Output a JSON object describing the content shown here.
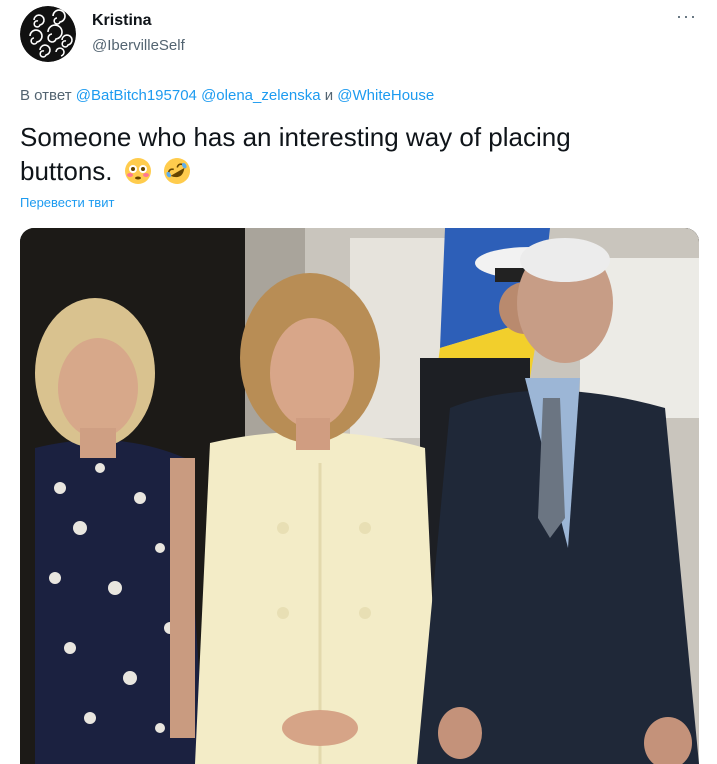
{
  "author": {
    "display_name": "Kristina",
    "handle": "@IbervilleSelf",
    "avatar_icon": "swirl-pattern-avatar"
  },
  "more_icon": "more-options-icon",
  "more_glyph": "···",
  "reply": {
    "prefix": "В ответ",
    "mention1": "@BatBitch195704",
    "mention2": "@olena_zelenska",
    "conjunction": "и",
    "mention3": "@WhiteHouse"
  },
  "tweet": {
    "line1": "Someone who has an interesting way of placing",
    "line2": "buttons.",
    "emoji": [
      "flushed-face-emoji",
      "rolling-on-floor-laughing-emoji"
    ]
  },
  "translate_link": "Перевести твит",
  "media": {
    "kind": "photo",
    "icon": "tweet-photo"
  },
  "colors": {
    "text": "#0f1419",
    "secondary": "#536471",
    "link": "#1d9bf0"
  }
}
